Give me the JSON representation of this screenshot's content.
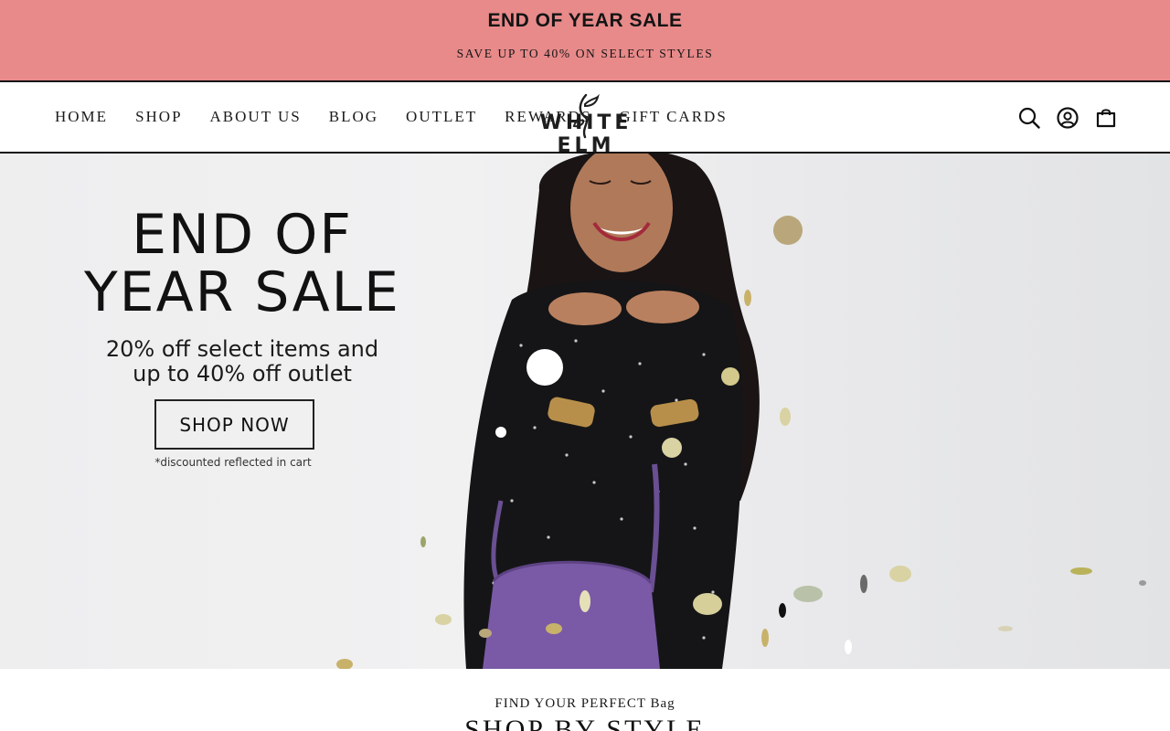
{
  "announcement": {
    "title": "END OF YEAR SALE",
    "subtitle": "SAVE UP TO 40% ON SELECT STYLES",
    "background": "#e88a8a"
  },
  "header": {
    "nav": [
      {
        "label": "HOME"
      },
      {
        "label": "SHOP"
      },
      {
        "label": "ABOUT US"
      },
      {
        "label": "BLOG"
      },
      {
        "label": "OUTLET"
      },
      {
        "label": "REWARDS"
      },
      {
        "label": "GIFT CARDS"
      }
    ],
    "logo_text": "WHITE ELM",
    "icons": [
      "search-icon",
      "account-icon",
      "cart-icon"
    ]
  },
  "hero": {
    "title_line1": "END OF",
    "title_line2": "YEAR SALE",
    "sub_line1": "20% off select items and",
    "sub_line2": "up to 40% off outlet",
    "cta_label": "SHOP NOW",
    "note": "*discounted reflected in cart",
    "bag_color": "#7a5aa6"
  },
  "section": {
    "kicker": "FIND YOUR PERFECT Bag",
    "title": "SHOP BY STYLE"
  }
}
